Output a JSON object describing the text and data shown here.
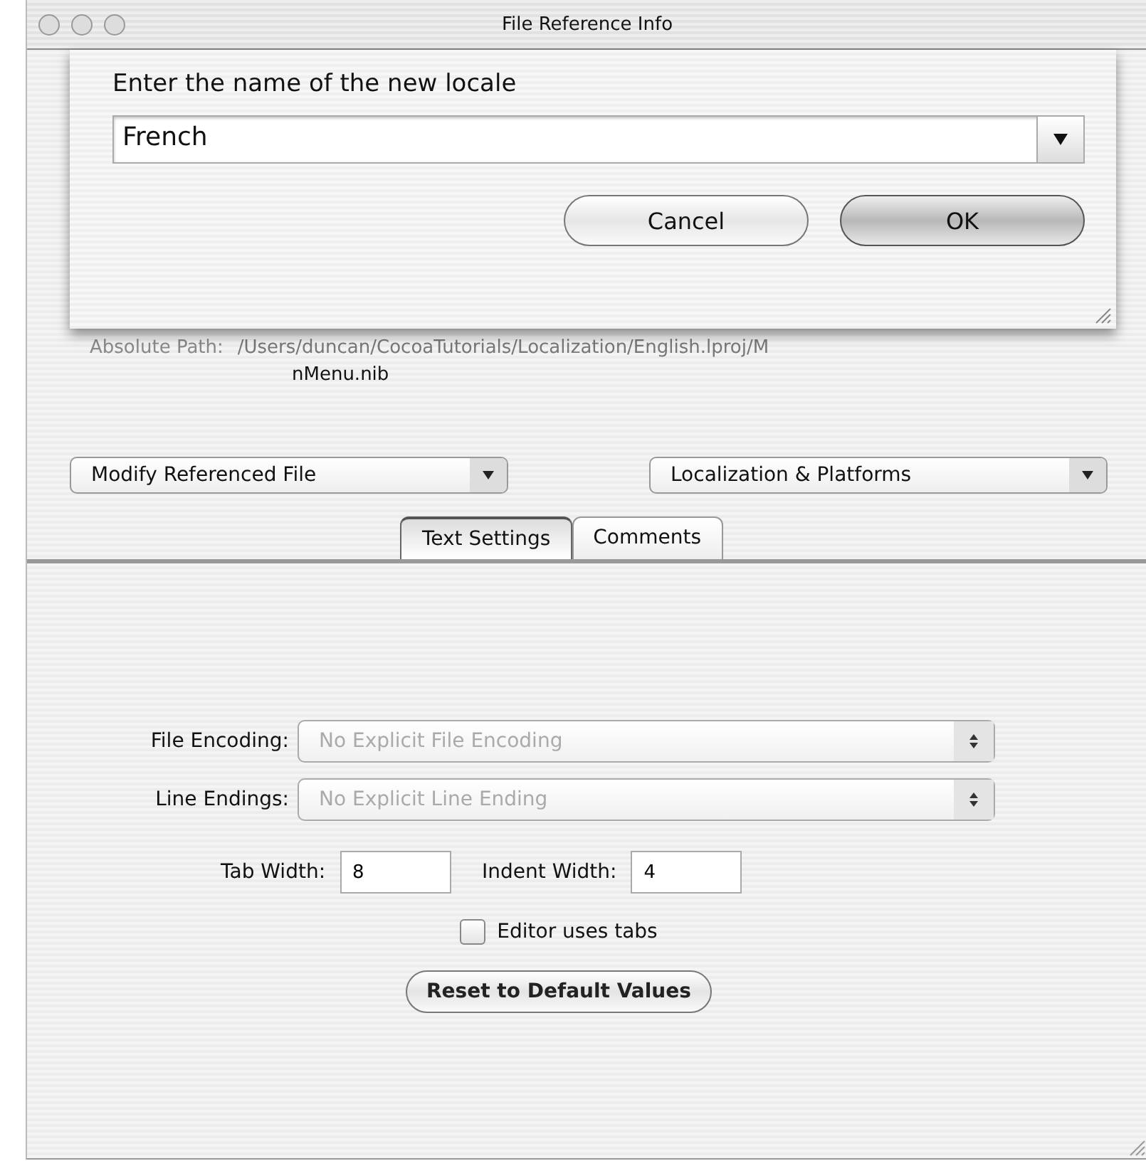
{
  "window": {
    "title": "File Reference Info"
  },
  "sheet": {
    "prompt": "Enter the name of the new locale",
    "combo_value": "French",
    "buttons": [
      {
        "label": "Cancel",
        "default": false
      },
      {
        "label": "OK",
        "default": true
      }
    ]
  },
  "absolute_path": {
    "label": "Absolute Path:",
    "value": "/Users/duncan/CocoaTutorials/Localization/English.lproj/M",
    "continuation": "nMenu.nib"
  },
  "popups": [
    {
      "label": "Modify Referenced File"
    },
    {
      "label": "Localization & Platforms"
    }
  ],
  "tabs": [
    {
      "label": "Text Settings",
      "selected": true
    },
    {
      "label": "Comments",
      "selected": false
    }
  ],
  "file_encoding": {
    "label": "File Encoding:",
    "value": "No Explicit File Encoding",
    "disabled": true
  },
  "line_endings": {
    "label": "Line Endings:",
    "value": "No Explicit Line Ending",
    "disabled": true
  },
  "tab_width": {
    "label": "Tab Width:",
    "value": "8"
  },
  "indent_width": {
    "label": "Indent Width:",
    "value": "4"
  },
  "editor_uses_tabs": {
    "label": "Editor uses tabs",
    "checked": false
  },
  "reset_button": "Reset to Default Values"
}
